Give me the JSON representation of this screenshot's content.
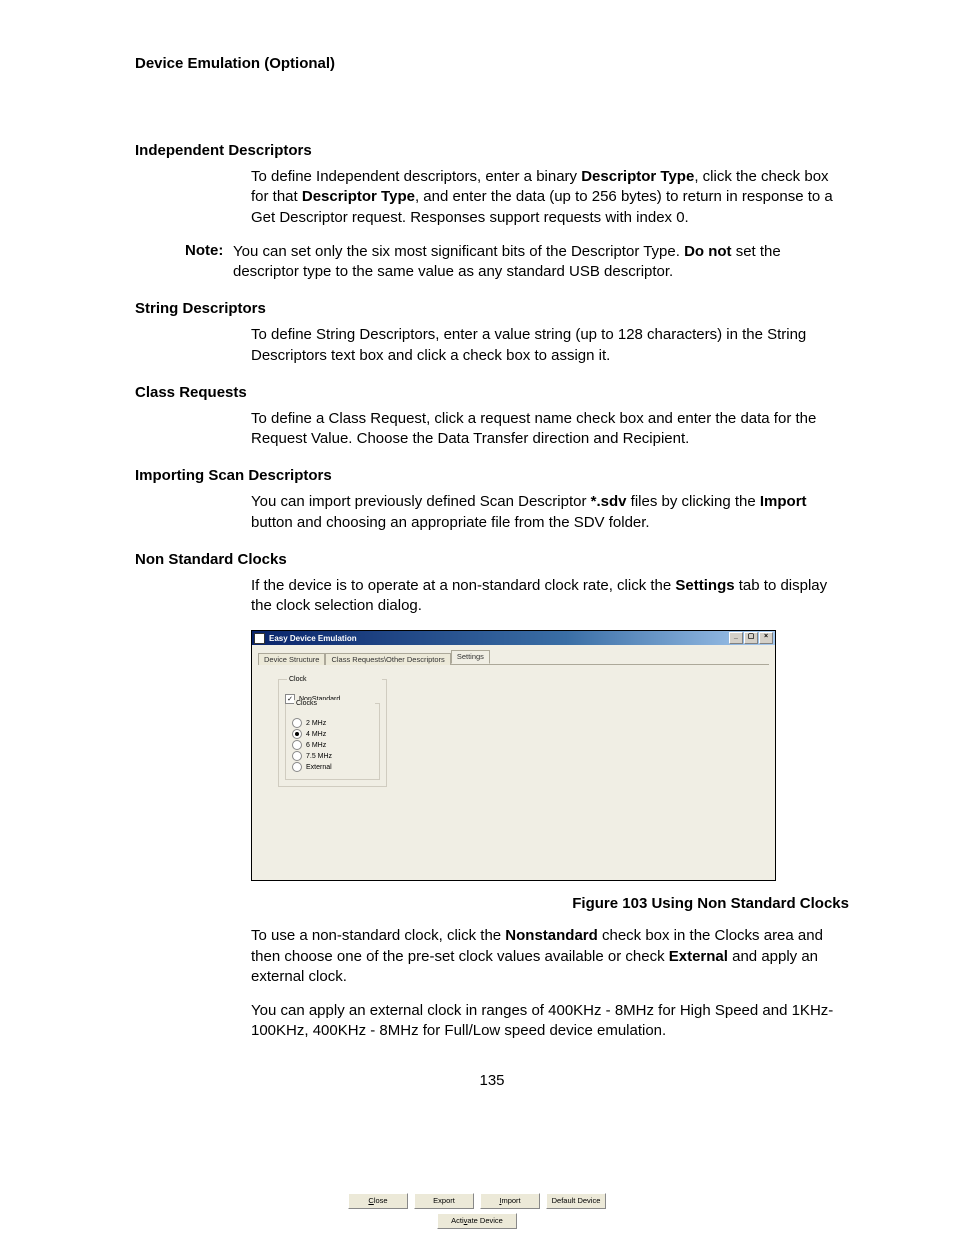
{
  "header": "Device Emulation (Optional)",
  "page_number": "135",
  "sections": {
    "independent": {
      "heading": "Independent Descriptors",
      "p1_a": "To define Independent descriptors, enter a binary ",
      "p1_b": "Descriptor Type",
      "p1_c": ", click the check box for that ",
      "p1_d": "Descriptor Type",
      "p1_e": ", and enter the data (up to 256 bytes) to return in response to a Get Descriptor request. Responses support requests with index 0."
    },
    "note": {
      "label": "Note:",
      "a": "You can set only the six most significant bits of the Descriptor Type. ",
      "b": "Do not",
      "c": " set the descriptor type to the same value as any standard USB descriptor."
    },
    "string": {
      "heading": "String Descriptors",
      "body": "To define String Descriptors, enter a value string (up to 128 characters) in the String Descriptors text box and click a check box to assign it."
    },
    "class": {
      "heading": "Class Requests",
      "body": "To define a Class Request, click a request name check box and enter the data for the Request Value. Choose the Data Transfer direction and Recipient."
    },
    "importing": {
      "heading": "Importing Scan Descriptors",
      "a": "You can import previously defined Scan Descriptor ",
      "b": "*.sdv",
      "c": " files by clicking the ",
      "d": "Import",
      "e": " button and choosing an appropriate file from the SDV folder."
    },
    "nonstd": {
      "heading": "Non Standard Clocks",
      "a": "If the device is to operate at a non-standard clock rate, click the ",
      "b": "Settings",
      "c": " tab to display the clock selection dialog."
    },
    "after_fig": {
      "p1_a": "To use a non-standard clock, click the ",
      "p1_b": "Nonstandard",
      "p1_c": " check box in the Clocks area and then choose one of the pre-set clock values available or check ",
      "p1_d": "External",
      "p1_e": " and apply an external clock.",
      "p2": "You can apply an external clock in ranges of 400KHz - 8MHz for High Speed and 1KHz-100KHz, 400KHz - 8MHz for Full/Low speed device emulation."
    }
  },
  "figure_caption": "Figure  103  Using Non Standard Clocks",
  "screenshot": {
    "title": "Easy Device Emulation",
    "tabs": [
      "Device Structure",
      "Class Requests\\Other Descriptors",
      "Settings"
    ],
    "selected_tab": 2,
    "clock_group_label": "Clock",
    "nonstandard_label": "NonStandard",
    "nonstandard_checked": true,
    "clocks_group_label": "Clocks",
    "clock_options": [
      {
        "label": "2   MHz",
        "checked": false
      },
      {
        "label": "4   MHz",
        "checked": true
      },
      {
        "label": "6   MHz",
        "checked": false
      },
      {
        "label": "7.5 MHz",
        "checked": false
      },
      {
        "label": "External",
        "checked": false
      }
    ],
    "buttons_row": [
      "Close",
      "Export",
      "Import",
      "Default Device"
    ],
    "button_bottom": "Activate Device"
  }
}
